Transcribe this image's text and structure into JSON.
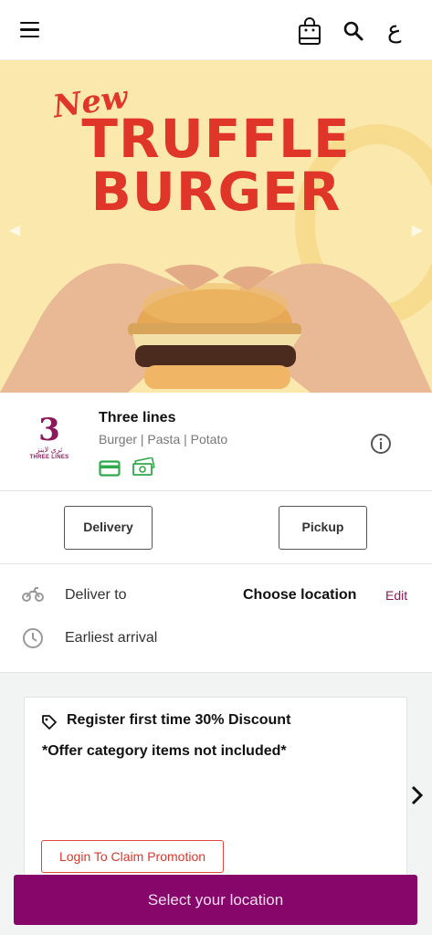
{
  "header": {
    "menu_icon": "hamburger-menu-icon",
    "cart_icon": "shopping-bag-icon",
    "search_icon": "search-icon",
    "language_label": "ع"
  },
  "banner": {
    "badge": "New",
    "title_line1": "TRUFFLE",
    "title_line2": "BURGER",
    "background_color": "#fbe8ac",
    "title_color": "#e0362a"
  },
  "restaurant": {
    "logo_number": "3",
    "logo_arabic": "ثري لاينز",
    "logo_text": "THREE LINES",
    "name": "Three lines",
    "categories": "Burger | Pasta | Potato",
    "payment_icons": [
      "credit-card-icon",
      "cash-icon"
    ],
    "info_icon": "info-icon"
  },
  "order_modes": {
    "delivery_label": "Delivery",
    "pickup_label": "Pickup"
  },
  "delivery": {
    "deliver_to_label": "Deliver to",
    "location_value": "Choose location",
    "edit_label": "Edit",
    "arrival_label": "Earliest arrival"
  },
  "promotion": {
    "title": "Register first time 30% Discount",
    "note": "*Offer category items not included*",
    "login_button": "Login To Claim Promotion"
  },
  "cta": {
    "label": "Select your location",
    "color": "#86066a"
  }
}
